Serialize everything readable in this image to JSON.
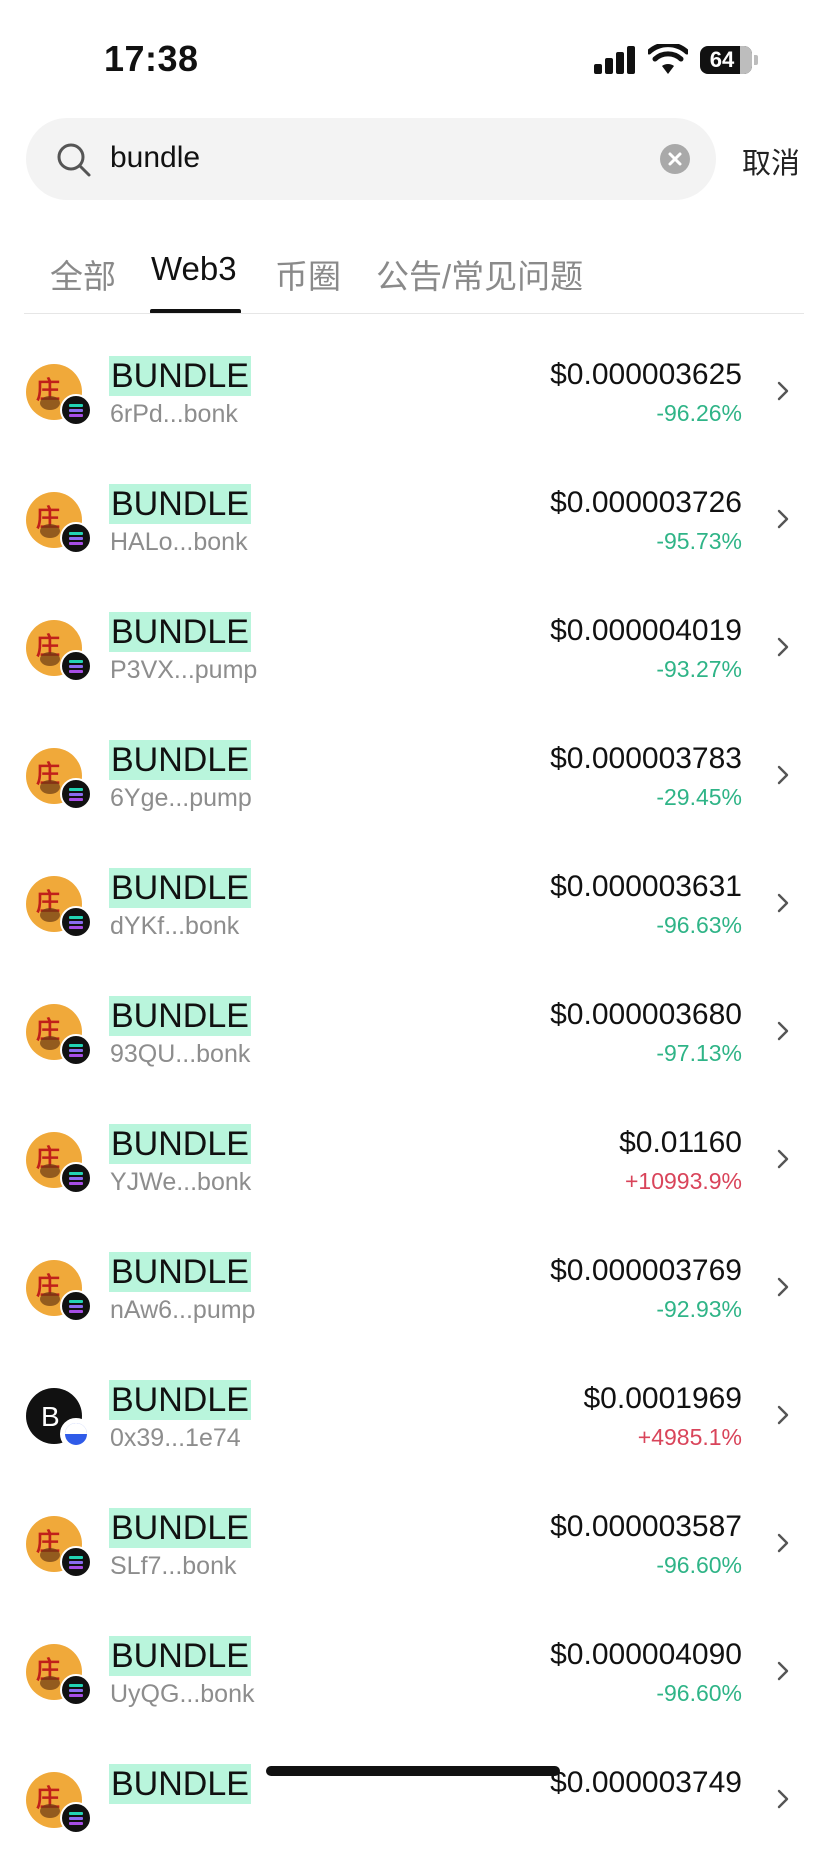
{
  "status_bar": {
    "time": "17:38",
    "battery": "64"
  },
  "search": {
    "query": "bundle",
    "cancel_label": "取消"
  },
  "tabs": [
    {
      "label": "全部",
      "active": false
    },
    {
      "label": "Web3",
      "active": true
    },
    {
      "label": "币圈",
      "active": false
    },
    {
      "label": "公告/常见问题",
      "active": false
    }
  ],
  "tokens": [
    {
      "name": "BUNDLE",
      "address": "6rPd...bonk",
      "price": "$0.000003625",
      "change": "-96.26%",
      "direction": "down",
      "icon": "token-avatar-icon",
      "chain": "solana-icon"
    },
    {
      "name": "BUNDLE",
      "address": "HALo...bonk",
      "price": "$0.000003726",
      "change": "-95.73%",
      "direction": "down",
      "icon": "token-avatar-icon",
      "chain": "solana-icon"
    },
    {
      "name": "BUNDLE",
      "address": "P3VX...pump",
      "price": "$0.000004019",
      "change": "-93.27%",
      "direction": "down",
      "icon": "token-avatar-icon",
      "chain": "solana-icon"
    },
    {
      "name": "BUNDLE",
      "address": "6Yge...pump",
      "price": "$0.000003783",
      "change": "-29.45%",
      "direction": "down",
      "icon": "token-avatar-icon",
      "chain": "solana-icon"
    },
    {
      "name": "BUNDLE",
      "address": "dYKf...bonk",
      "price": "$0.000003631",
      "change": "-96.63%",
      "direction": "down",
      "icon": "token-avatar-icon",
      "chain": "solana-icon"
    },
    {
      "name": "BUNDLE",
      "address": "93QU...bonk",
      "price": "$0.000003680",
      "change": "-97.13%",
      "direction": "down",
      "icon": "token-avatar-icon",
      "chain": "solana-icon"
    },
    {
      "name": "BUNDLE",
      "address": "YJWe...bonk",
      "price": "$0.01160",
      "change": "+10993.9%",
      "direction": "up",
      "icon": "token-avatar-icon",
      "chain": "solana-icon"
    },
    {
      "name": "BUNDLE",
      "address": "nAw6...pump",
      "price": "$0.000003769",
      "change": "-92.93%",
      "direction": "down",
      "icon": "token-avatar-icon",
      "chain": "solana-icon"
    },
    {
      "name": "BUNDLE",
      "address": "0x39...1e74",
      "price": "$0.0001969",
      "change": "+4985.1%",
      "direction": "up",
      "icon": "letter-b-avatar-icon",
      "avatar_letter": "B",
      "chain": "base-icon"
    },
    {
      "name": "BUNDLE",
      "address": "SLf7...bonk",
      "price": "$0.000003587",
      "change": "-96.60%",
      "direction": "down",
      "icon": "token-avatar-icon",
      "chain": "solana-icon"
    },
    {
      "name": "BUNDLE",
      "address": "UyQG...bonk",
      "price": "$0.000004090",
      "change": "-96.60%",
      "direction": "down",
      "icon": "token-avatar-icon",
      "chain": "solana-icon"
    },
    {
      "name": "BUNDLE",
      "address": "",
      "price": "$0.000003749",
      "change": "",
      "direction": "down",
      "icon": "token-avatar-icon",
      "chain": "solana-icon"
    }
  ],
  "colors": {
    "highlight": "#b9f5dc",
    "down": "#2fb487",
    "up": "#d9445a"
  }
}
